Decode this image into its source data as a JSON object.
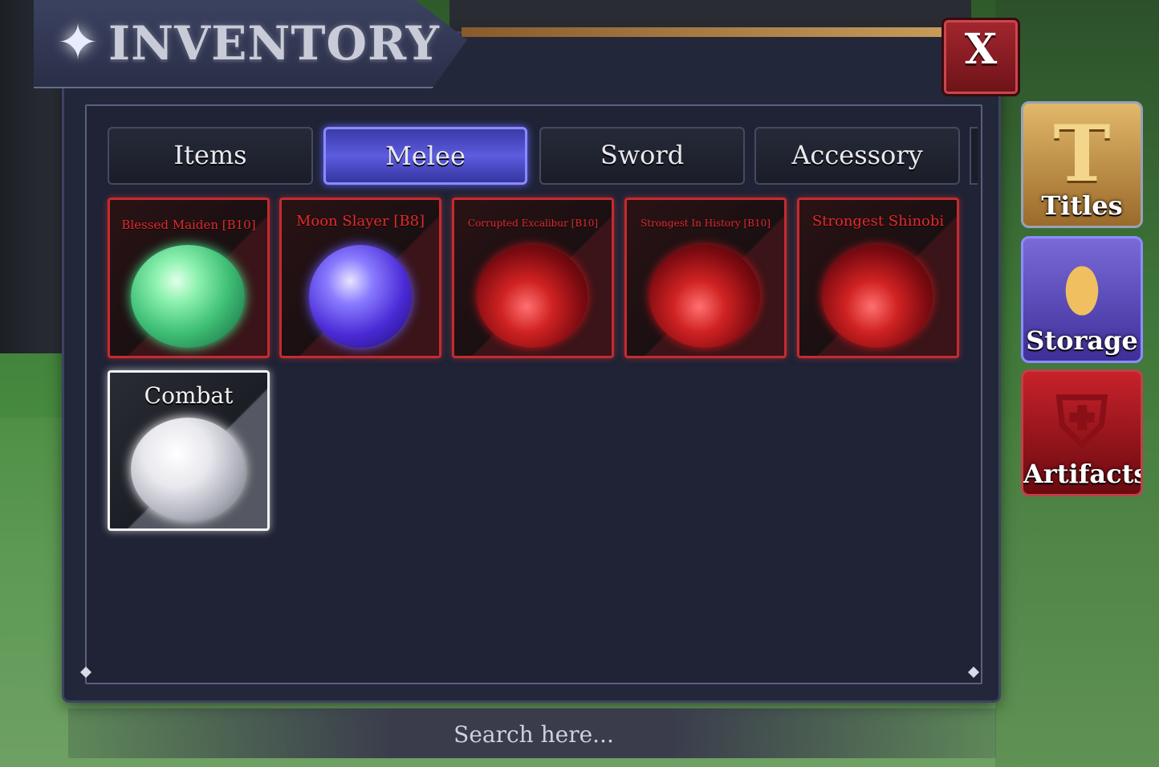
{
  "window": {
    "title": "INVENTORY",
    "close_label": "X"
  },
  "tabs": [
    {
      "label": "Items",
      "active": false
    },
    {
      "label": "Melee",
      "active": true
    },
    {
      "label": "Sword",
      "active": false
    },
    {
      "label": "Accessory",
      "active": false
    }
  ],
  "slots": [
    {
      "name": "Blessed Maiden [B10]",
      "orb": "green"
    },
    {
      "name": "Moon Slayer [B8]",
      "orb": "blue"
    },
    {
      "name": "Corrupted Excalibur [B10]",
      "orb": "red"
    },
    {
      "name": "Strongest In History [B10]",
      "orb": "red"
    },
    {
      "name": "Strongest Shinobi",
      "orb": "red"
    },
    {
      "name": "Combat",
      "orb": "white"
    }
  ],
  "side_buttons": [
    {
      "label": "Titles",
      "icon": "title-t-icon"
    },
    {
      "label": "Storage",
      "icon": "storage-capsule-icon"
    },
    {
      "label": "Artifacts",
      "icon": "helmet-icon"
    }
  ],
  "search": {
    "placeholder": "Search here..."
  },
  "colors": {
    "accent_active_tab": "#5c5ce0",
    "rarity_red": "#c42b30",
    "close_red": "#a3262e"
  }
}
